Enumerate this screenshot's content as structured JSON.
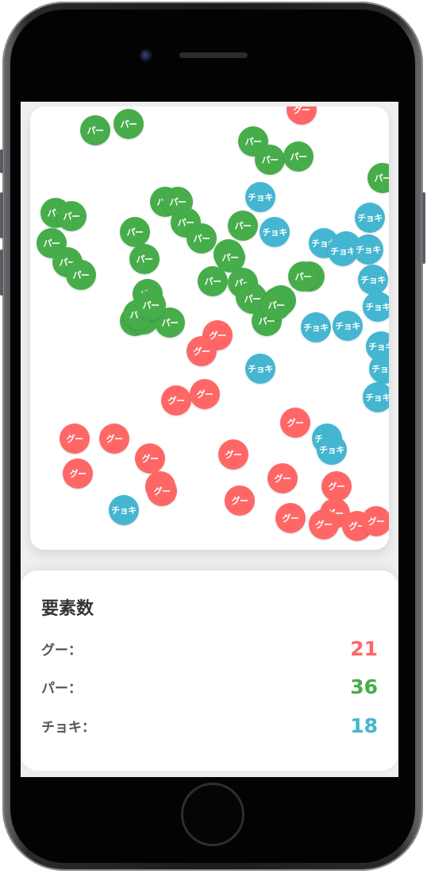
{
  "colors": {
    "rock": "#ff6767",
    "paper": "#46ad4a",
    "scissors": "#44b6d1"
  },
  "labels": {
    "rock": "グー",
    "paper": "パー",
    "scissors": "チョキ"
  },
  "stats": {
    "title": "要素数",
    "rows": [
      {
        "label": "グー：",
        "value": "21",
        "kind": "rock"
      },
      {
        "label": "パー：",
        "value": "36",
        "kind": "paper"
      },
      {
        "label": "チョキ：",
        "value": "18",
        "kind": "scissors"
      }
    ]
  }
}
